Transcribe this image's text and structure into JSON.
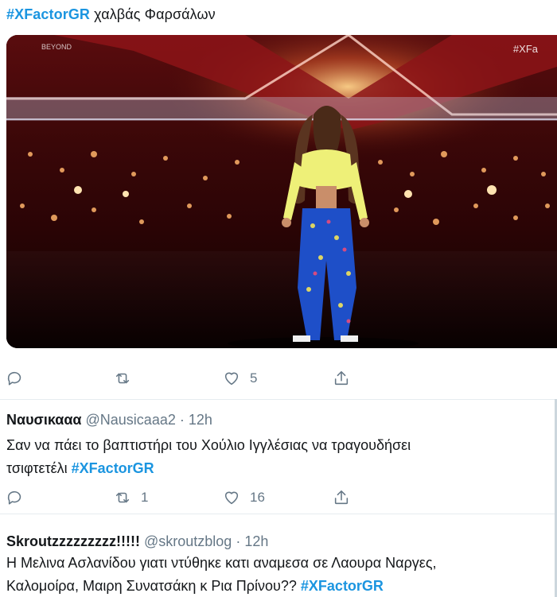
{
  "tweet": {
    "hashtag": "#XFactorGR",
    "text": " χαλβάς Φαρσάλων",
    "media_label": "XFactorGR stage performer",
    "media_tag_right": "#XFa",
    "media_tag_left": "BEYOND",
    "actions": {
      "reply_icon": "reply-icon",
      "retweet_icon": "retweet-icon",
      "retweet_count": "",
      "like_icon": "heart-icon",
      "like_count": "5",
      "share_icon": "share-icon"
    }
  },
  "replies": [
    {
      "name": "Ναυσικααα",
      "handle": "@Nausicaaa2",
      "separator": "·",
      "time": "12h",
      "text_line1": "Σαν να πάει το βαπτιστήρι του Χούλιο Ιγγλέσιας να τραγουδήσει",
      "text_line2": "τσιφτετέλι ",
      "hashtag": "#XFactorGR",
      "retweet_count": "1",
      "like_count": "16"
    },
    {
      "name": "Skroutzzzzzzzzz!!!!!",
      "handle": "@skroutzblog",
      "separator": "·",
      "time": "12h",
      "text_line1": "Η Μελινα Ασλανίδου γιατι ντύθηκε κατι αναμεσα σε Λαουρα Ναργες,",
      "text_line2": "Καλομοίρα, Μαιρη Συνατσάκη κ Ρια Πρίνου?? ",
      "hashtag": "#XFactorGR"
    }
  ],
  "colors": {
    "link": "#1b95e0",
    "muted": "#657786",
    "divider": "#e6ecf0"
  }
}
